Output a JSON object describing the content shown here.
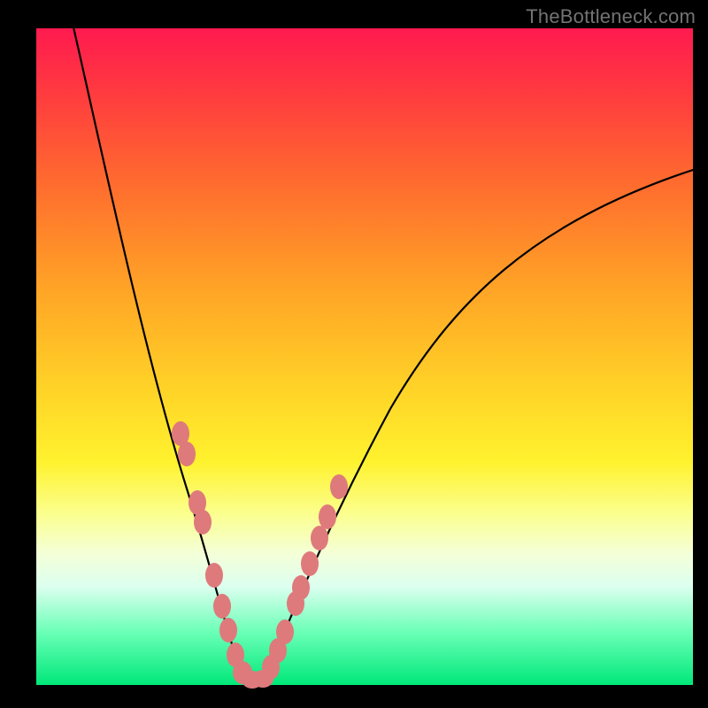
{
  "watermark": "TheBottleneck.com",
  "colors": {
    "gradient_top": "#ff1a4f",
    "gradient_bottom": "#00e87a",
    "curve": "#000000",
    "markers": "#de7a7c",
    "frame": "#000000"
  },
  "chart_data": {
    "type": "line",
    "title": "",
    "xlabel": "",
    "ylabel": "",
    "xlim": [
      0,
      100
    ],
    "ylim": [
      0,
      100
    ],
    "x": [
      5,
      10,
      15,
      18,
      20,
      22,
      24,
      26,
      28,
      29,
      30,
      31,
      32,
      33,
      34,
      36,
      38,
      40,
      44,
      50,
      60,
      70,
      80,
      90,
      100
    ],
    "values": [
      100,
      85,
      67,
      55,
      45,
      36,
      28,
      20,
      12,
      8,
      4,
      2,
      1,
      2,
      4,
      8,
      14,
      20,
      32,
      45,
      60,
      70,
      77,
      82,
      84
    ],
    "series": [
      {
        "name": "left-markers",
        "x": [
          21.5,
          22.3,
          24.0,
          24.8,
          26.6,
          27.6,
          28.6,
          29.7,
          30.8
        ],
        "values": [
          39,
          36,
          28,
          25,
          17,
          12,
          8,
          4,
          2
        ]
      },
      {
        "name": "right-markers",
        "x": [
          33.2,
          34.3,
          35.2,
          36.8,
          37.6,
          38.8,
          40.3,
          41.5,
          43.2
        ],
        "values": [
          2,
          4,
          7,
          11,
          14,
          18,
          22,
          26,
          31
        ]
      }
    ],
    "annotations": []
  }
}
